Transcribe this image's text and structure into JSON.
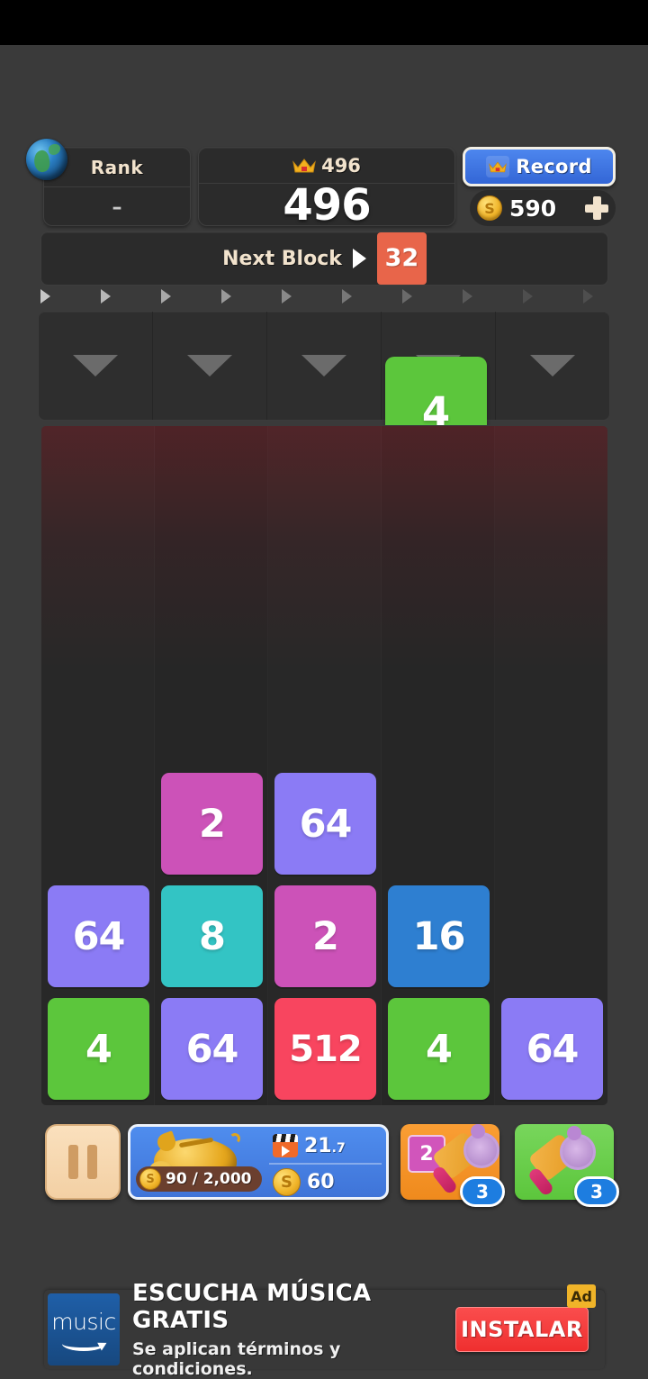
{
  "header": {
    "rank": {
      "label": "Rank",
      "value": "–",
      "icon": "globe-icon"
    },
    "best": {
      "icon": "crown-icon",
      "value": "496"
    },
    "score": "496",
    "record_button": {
      "label": "Record",
      "icon": "crown-icon"
    },
    "coins": {
      "icon": "coin-icon",
      "value": "590",
      "add_icon": "plus-icon"
    }
  },
  "next_block": {
    "label": "Next Block",
    "caret_icon": "caret-right-icon",
    "value": "32",
    "color": "#e8654a"
  },
  "queue_arrows": {
    "count": 10,
    "icon": "caret-right-icon"
  },
  "dropzone": {
    "columns": 5,
    "arrow_icon": "caret-down-icon"
  },
  "falling_tile": {
    "value": "4",
    "color": "#5cc63c",
    "column": 4
  },
  "board": {
    "columns": 5,
    "rows": 6,
    "tile_colors": {
      "2": "#cc52b8",
      "4": "#5cc63c",
      "8": "#33c4c4",
      "16": "#2e7fd1",
      "64": "#8b7bf5",
      "512": "#f8455f"
    },
    "tiles": [
      {
        "value": "2",
        "color": "#cc52b8",
        "col": 1,
        "row": 3
      },
      {
        "value": "64",
        "color": "#8b7bf5",
        "col": 2,
        "row": 3
      },
      {
        "value": "64",
        "color": "#8b7bf5",
        "col": 0,
        "row": 4
      },
      {
        "value": "8",
        "color": "#33c4c4",
        "col": 1,
        "row": 4
      },
      {
        "value": "2",
        "color": "#cc52b8",
        "col": 2,
        "row": 4
      },
      {
        "value": "16",
        "color": "#2e7fd1",
        "col": 3,
        "row": 4
      },
      {
        "value": "4",
        "color": "#5cc63c",
        "col": 0,
        "row": 5
      },
      {
        "value": "64",
        "color": "#8b7bf5",
        "col": 1,
        "row": 5
      },
      {
        "value": "512",
        "color": "#f8455f",
        "col": 2,
        "row": 5
      },
      {
        "value": "4",
        "color": "#5cc63c",
        "col": 3,
        "row": 5
      },
      {
        "value": "64",
        "color": "#8b7bf5",
        "col": 4,
        "row": 5
      }
    ]
  },
  "bottom_bar": {
    "pause": {
      "icon": "pause-icon"
    },
    "piggy": {
      "icon": "piggy-bank-icon",
      "coin_icon": "coin-icon",
      "progress": "90 / 2,000",
      "video_icon": "video-ad-icon",
      "video_value": "21",
      "video_value_sub": ".7",
      "coin_value": "60"
    },
    "powerups": [
      {
        "name": "tile-hammer",
        "icon": "hammer-icon",
        "tile_value": "2",
        "count": "3",
        "color": "#f59421"
      },
      {
        "name": "column-hammer",
        "icon": "hammer-icon",
        "count": "3",
        "color": "#5cc63c"
      }
    ]
  },
  "ad": {
    "logo_text": "music",
    "title": "ESCUCHA MÚSICA GRATIS",
    "subtitle": "Se aplican términos y condiciones.",
    "cta": "INSTALAR",
    "badge": "Ad"
  }
}
